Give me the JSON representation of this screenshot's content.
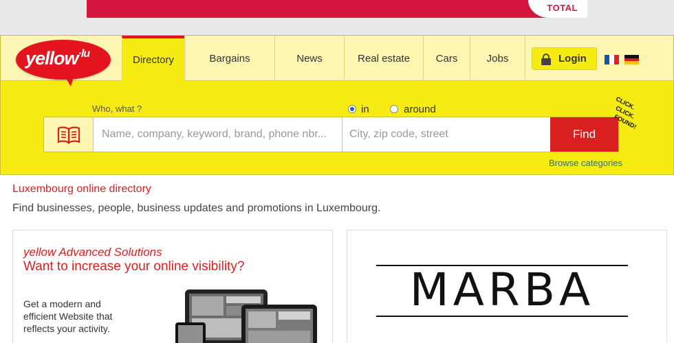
{
  "ad": {
    "brand": "TOTAL"
  },
  "logo": {
    "main": "yellow",
    "suffix": "·lu"
  },
  "nav": {
    "tabs": [
      {
        "label": "Directory"
      },
      {
        "label": "Bargains"
      },
      {
        "label": "News"
      },
      {
        "label": "Real estate"
      },
      {
        "label": "Cars"
      },
      {
        "label": "Jobs"
      }
    ],
    "login_label": "Login",
    "languages": [
      "fr",
      "de"
    ]
  },
  "search": {
    "what_label": "Who, what ?",
    "what_placeholder": "Name, company, keyword, brand, phone nbr...",
    "where_placeholder": "City, zip code, street",
    "radio_in": "in",
    "radio_around": "around",
    "radio_selected": "in",
    "find_label": "Find",
    "browse_label": "Browse categories",
    "slogan": [
      "CLICK.",
      "CLICK.",
      "FOUND!"
    ]
  },
  "content": {
    "title": "Luxembourg online directory",
    "subtitle": "Find businesses, people, business updates and promotions in Luxembourg.",
    "promo": {
      "kicker": "yellow Advanced Solutions",
      "headline": "Want to increase your online visibility?",
      "text": "Get a modern and efficient Website that reflects your activity."
    },
    "ad_brand": "MARBA"
  },
  "colors": {
    "accent_red": "#d9201f",
    "header_yellow": "#f7eb14",
    "link_blue": "#1d6fa5"
  }
}
